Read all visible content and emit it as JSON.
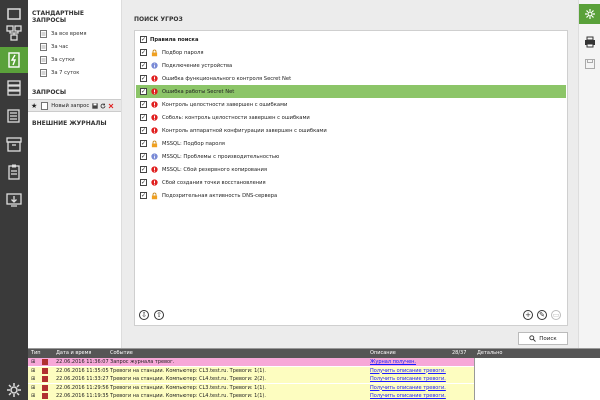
{
  "tree": {
    "standard_header": "СТАНДАРТНЫЕ ЗАПРОСЫ",
    "standard_items": [
      "За все время",
      "За час",
      "За сутки",
      "За 7 суток"
    ],
    "queries_header": "ЗАПРОСЫ",
    "query_item": "Новый запрос",
    "external_header": "ВНЕШНИЕ ЖУРНАЛЫ"
  },
  "main": {
    "title": "ПОИСК УГРОЗ",
    "rules_header": "Правила поиска",
    "rules": [
      {
        "label": "Подбор пароля",
        "icon": "lock",
        "selected": false
      },
      {
        "label": "Подключение устройства",
        "icon": "info",
        "selected": false
      },
      {
        "label": "Ошибка функционального контроля Secret Net",
        "icon": "error",
        "selected": false
      },
      {
        "label": "Ошибка работы Secret Net",
        "icon": "error",
        "selected": true
      },
      {
        "label": "Контроль целостности завершен с ошибками",
        "icon": "error",
        "selected": false
      },
      {
        "label": "Соболь: контроль целостности завершен с ошибками",
        "icon": "error",
        "selected": false
      },
      {
        "label": "Контроль аппаратной конфигурации завершен с ошибками",
        "icon": "error",
        "selected": false
      },
      {
        "label": "MSSQL: Подбор пароля",
        "icon": "lock",
        "selected": false
      },
      {
        "label": "MSSQL: Проблемы с производительностью",
        "icon": "info",
        "selected": false
      },
      {
        "label": "MSSQL: Сбой резервного копирования",
        "icon": "error",
        "selected": false
      },
      {
        "label": "Сбой создания точки восстановления",
        "icon": "error",
        "selected": false
      },
      {
        "label": "Подозрительная активность DNS-сервера",
        "icon": "lock",
        "selected": false
      }
    ],
    "search_label": "Поиск"
  },
  "journal": {
    "columns": {
      "type": "Тип",
      "datetime": "Дата и время",
      "event": "Событие",
      "description": "Описание",
      "count": "28/37",
      "details": "Детально"
    },
    "rows": [
      {
        "datetime": "22.06.2016 11:36:07",
        "event": "Запрос журнала тревог.",
        "description": "Журнал получен.",
        "color": "#f7a8d8"
      },
      {
        "datetime": "22.06.2016 11:35:05",
        "event": "Тревоги на станции. Компьютер: CL3.test.ru. Тревоги: 1(1).",
        "description": "Получить описание тревоги.",
        "color": "#fdfdc0"
      },
      {
        "datetime": "22.06.2016 11:33:27",
        "event": "Тревоги на станции. Компьютер: CL4.test.ru. Тревоги: 2(2).",
        "description": "Получить описание тревоги.",
        "color": "#fdfdc0"
      },
      {
        "datetime": "22.06.2016 11:29:56",
        "event": "Тревоги на станции. Компьютер: CL3.test.ru. Тревоги: 1(1).",
        "description": "Получить описание тревоги.",
        "color": "#fdfdc0"
      },
      {
        "datetime": "22.06.2016 11:19:35",
        "event": "Тревоги на станции. Компьютер: CL4.test.ru. Тревоги: 1(1).",
        "description": "Получить описание тревоги.",
        "color": "#fdfdc0"
      }
    ]
  },
  "colors": {
    "accent": "#5aa13a",
    "selected_row": "#8cc568",
    "error": "#e02020",
    "info": "#7a8bd6",
    "lock": "#f0a020"
  }
}
